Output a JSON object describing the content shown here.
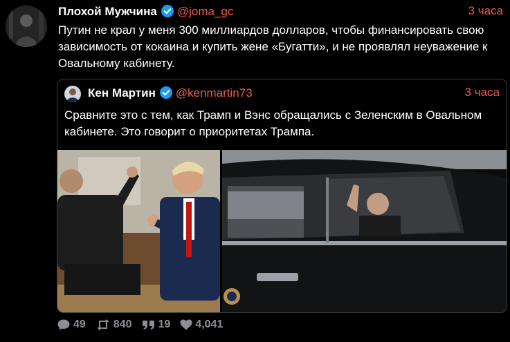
{
  "tweet": {
    "author_name": "Плохой Мужчина",
    "author_handle": "@joma_gc",
    "time": "3 часа",
    "text": "Путин не крал у меня 300 миллиардов долларов, чтобы финансировать свою зависимость от кокаина и купить жене «Бугатти», и не проявлял неуважение к Овальному кабинету."
  },
  "quote": {
    "author_name": "Кен Мартин",
    "author_handle": "@kenmartin73",
    "time": "3 часа",
    "text": "Сравните это с тем, как Трамп и Вэнс обращались с Зеленским в Овальном кабинете. Это говорит о приоритетах Трампа."
  },
  "actions": {
    "replies": "49",
    "retweets": "840",
    "quotes": "19",
    "likes": "4,041"
  },
  "colors": {
    "accent": "#f15a4e",
    "verified": "#1d9bf0",
    "muted": "#8b8f94",
    "background": "#000000"
  },
  "icons": [
    "verified-badge-icon",
    "reply-icon",
    "retweet-icon",
    "quote-icon",
    "heart-icon"
  ]
}
